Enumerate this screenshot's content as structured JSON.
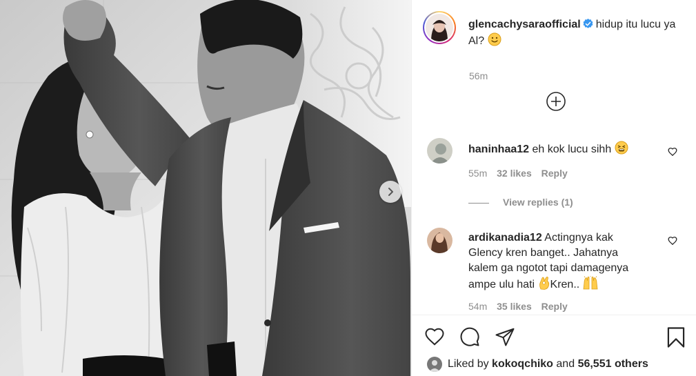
{
  "post": {
    "author": "glencachysaraofficial",
    "caption": "hidup itu lucu ya Al?",
    "caption_emoji": "slightly-smiling-face",
    "time": "56m"
  },
  "comments": [
    {
      "user": "haninhaa12",
      "text": "eh kok lucu sihh",
      "emoji": "tired-face",
      "time": "55m",
      "likes": "32 likes",
      "reply": "Reply",
      "view_replies": "View replies (1)"
    },
    {
      "user": "ardikanadia12",
      "text_1": "Actingnya kak Glency kren banget.. Jahatnya kalem ga ngotot tapi damagenya ampe ulu hati",
      "text_2": "Kren..",
      "emoji_1": "ok-hand",
      "emoji_2": "raising-hands",
      "time": "54m",
      "likes": "35 likes",
      "reply": "Reply"
    }
  ],
  "liked_by": {
    "prefix": "Liked by",
    "user": "kokoqchiko",
    "joiner": "and",
    "others": "56,551 others"
  },
  "icons": [
    "verified-icon",
    "add-icon",
    "heart-icon",
    "comment-icon",
    "share-icon",
    "bookmark-icon",
    "next-arrow-icon"
  ],
  "colors": {
    "verified": "#3897f0",
    "meta": "#8e8e8e",
    "text": "#262626"
  }
}
